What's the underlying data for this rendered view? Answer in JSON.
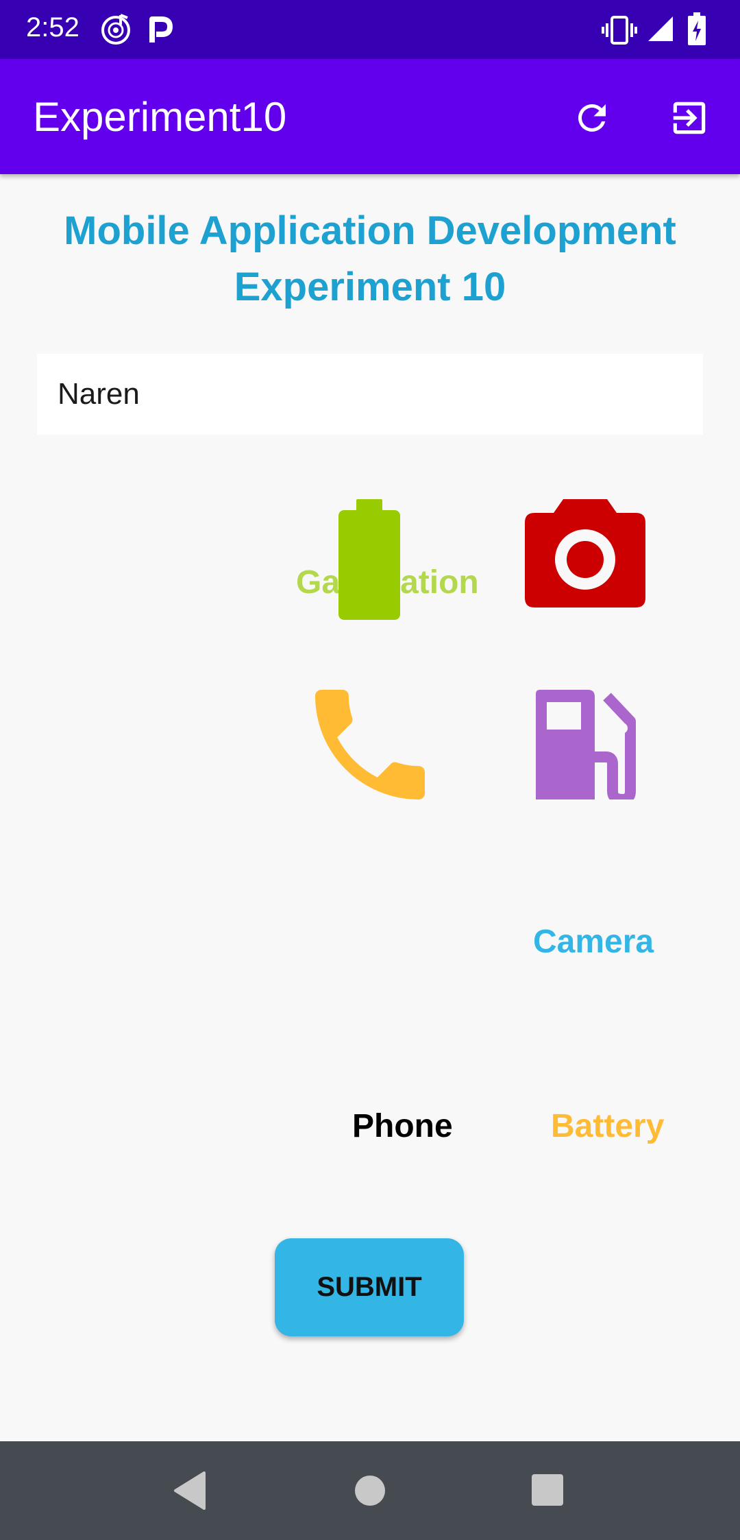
{
  "status_bar": {
    "time": "2:52",
    "icons": [
      "music-app-icon",
      "p-app-icon",
      "vibrate-icon",
      "signal-icon",
      "battery-charging-icon"
    ]
  },
  "app_bar": {
    "title": "Experiment10",
    "actions": [
      "refresh-icon",
      "exit-icon"
    ]
  },
  "heading": {
    "line1": "Mobile Application Development",
    "line2": "Experiment 10"
  },
  "name_input": {
    "value": "Naren"
  },
  "labels": {
    "gas_station": "Gas Station",
    "camera": "Camera",
    "phone": "Phone",
    "battery": "Battery"
  },
  "submit": {
    "label": "SUBMIT"
  },
  "colors": {
    "status_bar": "#3700b3",
    "app_bar": "#6200ee",
    "heading": "#1da1d1",
    "battery_icon": "#99cc00",
    "camera_icon": "#cc0000",
    "phone_icon": "#ffbb33",
    "gas_icon": "#aa66cc",
    "gas_label": "#b3d84d",
    "camera_label": "#33b5e5",
    "phone_label": "#000000",
    "battery_label": "#ffbb33",
    "submit_button": "#33b5e5",
    "nav_bar": "#454b51"
  },
  "nav_bar": {
    "buttons": [
      "back-icon",
      "home-icon",
      "recents-icon"
    ]
  }
}
